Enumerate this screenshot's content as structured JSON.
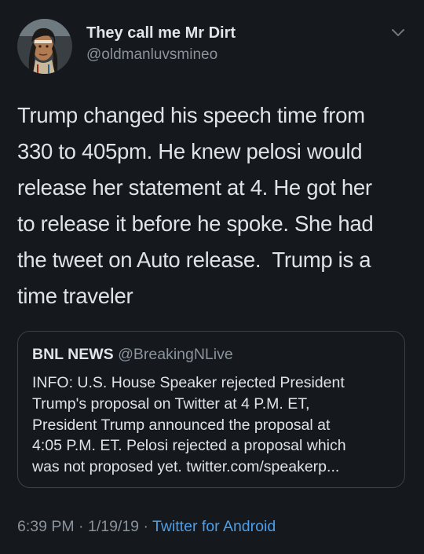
{
  "author": {
    "name": "They call me Mr Dirt",
    "handle": "@oldmanluvsmineo",
    "avatar_icon": "user-avatar-portrait"
  },
  "menu": {
    "icon": "chevron-down-icon"
  },
  "tweet": {
    "lines": [
      "Trump changed his speech time from",
      "330 to 405pm. He knew pelosi would",
      "release her statement at 4. He got her",
      "to release it before he spoke. She had",
      "the tweet on Auto release.  Trump is a",
      "time traveler"
    ]
  },
  "quoted": {
    "name": "BNL NEWS",
    "handle": "@BreakingNLive",
    "lines": [
      "INFO: U.S. House Speaker rejected President",
      "Trump's proposal on Twitter at 4 P.M. ET,",
      "President Trump announced the proposal at",
      "4:05 P.M. ET. Pelosi rejected a proposal which",
      "was not proposed yet. twitter.com/speakerp..."
    ]
  },
  "meta": {
    "time": "6:39 PM",
    "date": "1/19/19",
    "separator": " · ",
    "source": "Twitter for Android"
  },
  "colors": {
    "background": "#15181c",
    "text": "#dfe3e7",
    "secondary": "#8a939c",
    "link": "#4d9ee6",
    "border": "#3b4148"
  }
}
